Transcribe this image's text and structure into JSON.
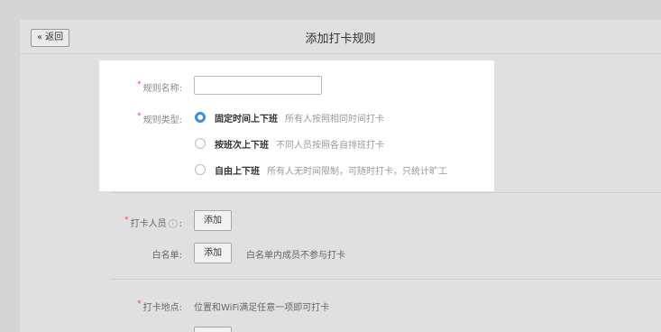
{
  "header": {
    "back_label": "返回",
    "back_icon": "«",
    "title": "添加打卡规则"
  },
  "rule_name": {
    "label": "规则名称:",
    "value": ""
  },
  "rule_type": {
    "label": "规则类型:",
    "options": [
      {
        "title": "固定时间上下班",
        "desc": "所有人按照相同时间打卡",
        "selected": true
      },
      {
        "title": "按班次上下班",
        "desc": "不同人员按照各自排班打卡",
        "selected": false
      },
      {
        "title": "自由上下班",
        "desc": "所有人无时间限制，可随时打卡，只统计旷工",
        "selected": false
      }
    ]
  },
  "members": {
    "label": "打卡人员",
    "suffix": ":",
    "add_label": "添加"
  },
  "whitelist": {
    "label": "白名单:",
    "add_label": "添加",
    "hint": "白名单内成员不参与打卡"
  },
  "location": {
    "label": "打卡地点:",
    "hint": "位置和WiFi满足任意一项即可打卡"
  },
  "colors": {
    "accent": "#3b8ee0",
    "required": "#f04848"
  }
}
